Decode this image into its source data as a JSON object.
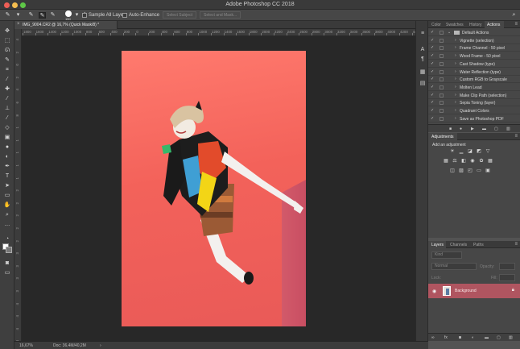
{
  "window": {
    "title": "Adobe Photoshop CC 2018"
  },
  "options": {
    "brush_size": "150",
    "sample_all_layers": "Sample All Layers",
    "auto_enhance": "Auto-Enhance",
    "select_subject": "Select Subject",
    "select_and_mask": "Select and Mask..."
  },
  "document": {
    "tab_title": "IMG_9004.CR2 @ 16,7% (Quick Mask/8) *",
    "zoom": "16,67%",
    "doc_size": "Doc: 36,4M/40,2M"
  },
  "ruler": {
    "h_labels": [
      "1800",
      "1600",
      "1400",
      "1200",
      "1000",
      "800",
      "600",
      "400",
      "200",
      "0",
      "200",
      "400",
      "600",
      "800",
      "1000",
      "1200",
      "1400",
      "1600",
      "1800",
      "2000",
      "2200",
      "2400",
      "2600",
      "2800",
      "3000",
      "3200",
      "3400",
      "3600",
      "3800",
      "4000",
      "4200",
      "4400",
      "460"
    ],
    "v_labels": [
      "4",
      "2",
      "0",
      "2",
      "4",
      "6",
      "8",
      "1",
      "1",
      "1",
      "1",
      "1",
      "2",
      "2",
      "2",
      "2",
      "2",
      "3",
      "3",
      "3",
      "3",
      "4",
      "4",
      "4",
      "4"
    ]
  },
  "panels": {
    "top_tabs": [
      "Color",
      "Swatches",
      "History",
      "Actions"
    ],
    "actions": [
      {
        "label": "Default Actions",
        "type": "folder"
      },
      {
        "label": "Vignette (selection)"
      },
      {
        "label": "Frame Channel - 50 pixel"
      },
      {
        "label": "Wood Frame - 50 pixel"
      },
      {
        "label": "Cast Shadow (type)"
      },
      {
        "label": "Water Reflection (type)"
      },
      {
        "label": "Custom RGB to Grayscale"
      },
      {
        "label": "Molten Lead"
      },
      {
        "label": "Make Clip Path (selection)"
      },
      {
        "label": "Sepia Toning (layer)"
      },
      {
        "label": "Quadrant Colors"
      },
      {
        "label": "Save as Photoshop PDF"
      }
    ],
    "adjustments": {
      "title": "Adjustments",
      "subtitle": "Add an adjustment"
    },
    "layer_tabs": [
      "Layers",
      "Channels",
      "Paths"
    ],
    "layers": {
      "filter_label": "Kind",
      "blend_mode": "Normal",
      "opacity_label": "Opacity:",
      "lock_label": "Lock:",
      "fill_label": "Fill:",
      "background_name": "Background"
    }
  },
  "colors": {
    "canvas_bg": "#282828",
    "quick_mask_red": "#f3625a",
    "layer_selected": "#b05560"
  },
  "chart_data": null
}
